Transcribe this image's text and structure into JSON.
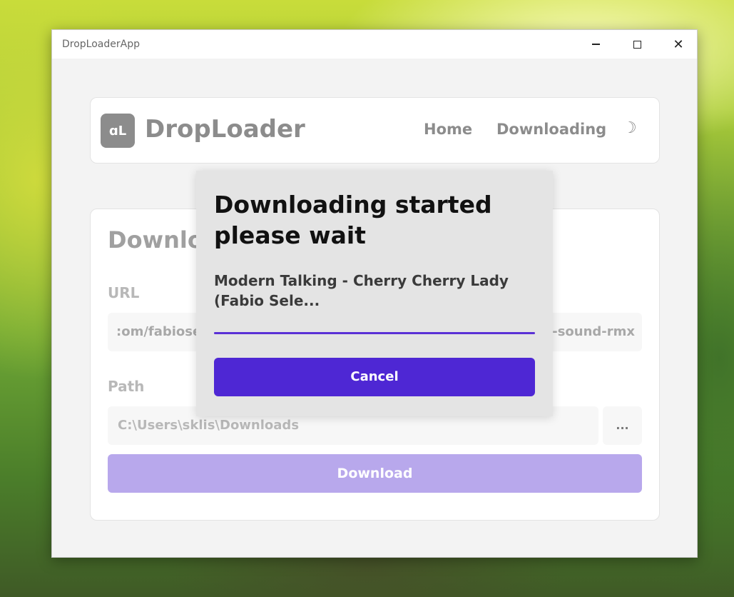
{
  "window": {
    "title": "DropLoaderApp"
  },
  "header": {
    "logo_text": "ɑL",
    "brand": "DropLoader",
    "nav": {
      "home": "Home",
      "downloading": "Downloading"
    },
    "theme_icon": "☽"
  },
  "main": {
    "title": "Downlo",
    "url_label": "URL",
    "url_value_left": ":om/fabiose",
    "url_value_right": "r-sound-rmx",
    "path_label": "Path",
    "path_value": "C:\\Users\\sklis\\Downloads",
    "browse_label": "...",
    "download_label": "Download"
  },
  "dialog": {
    "title": "Downloading started please wait",
    "song": "Modern Talking - Cherry Cherry Lady (Fabio Sele...",
    "progress": 1.0,
    "cancel_label": "Cancel"
  },
  "colors": {
    "accent": "#4e27d4",
    "accent_disabled": "#b8a8ec"
  }
}
